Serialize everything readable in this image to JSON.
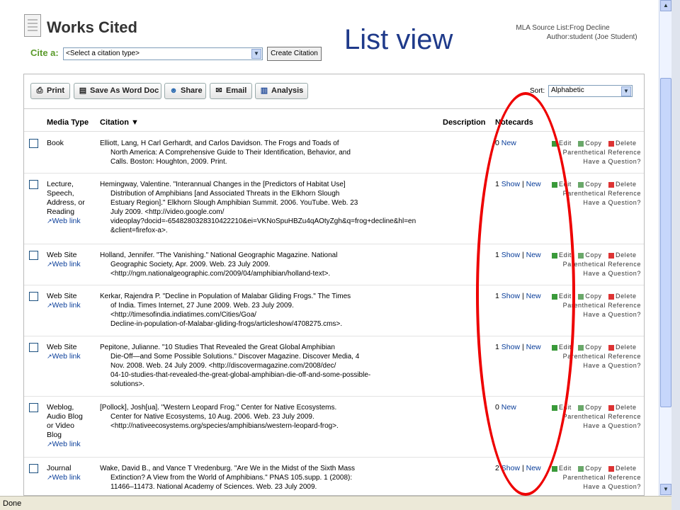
{
  "header": {
    "title": "Works Cited",
    "overlay_label": "List view",
    "source_list_key": "MLA Source List:",
    "source_list_value": "Frog Decline",
    "author_key": "Author:",
    "author_value": "student (Joe Student)",
    "cite_label": "Cite a:",
    "cite_select_value": "<Select a citation type>",
    "create_button": "Create Citation"
  },
  "toolbar": {
    "print": "Print",
    "word": "Save As Word Doc",
    "share": "Share",
    "email": "Email",
    "analysis": "Analysis",
    "sort_label": "Sort:",
    "sort_value": "Alphabetic"
  },
  "columns": {
    "media_type": "Media Type",
    "citation": "Citation ▼",
    "description": "Description",
    "notecards": "Notecards"
  },
  "actions": {
    "edit": "Edit",
    "copy": "Copy",
    "delete": "Delete",
    "parenthetical": "Parenthetical Reference",
    "question": "Have a Question?"
  },
  "links": {
    "web_link": "Web link",
    "show": "Show",
    "new": "New",
    "sep": "|"
  },
  "rows": [
    {
      "media": [
        "Book"
      ],
      "web_link": false,
      "citation": [
        "Elliott, Lang, H Carl Gerhardt, and Carlos Davidson. The Frogs and Toads of",
        "North America: A Comprehensive Guide to Their Identification, Behavior, and",
        "Calls. Boston: Houghton, 2009. Print."
      ],
      "count": "0",
      "show": false
    },
    {
      "media": [
        "Lecture,",
        "Speech,",
        "Address, or",
        "Reading"
      ],
      "web_link": true,
      "citation": [
        "Hemingway, Valentine. \"Interannual Changes in the [Predictors of Habitat Use]",
        "Distribution of Amphibians [and Associated Threats in the Elkhorn Slough",
        "Estuary Region].\" Elkhorn Slough Amphibian Summit. 2006. YouTube. Web. 23",
        "July 2009. <http://video.google.com/",
        "videoplay?docid=-6548280328310422210&ei=VKNoSpuHBZu4qAOtyZgh&q=frog+decline&hl=en",
        "&client=firefox-a>."
      ],
      "count": "1",
      "show": true
    },
    {
      "media": [
        "Web Site"
      ],
      "web_link": true,
      "citation": [
        "Holland, Jennifer. \"The Vanishing.\" National Geographic Magazine. National",
        "Geographic Society, Apr. 2009. Web. 23 July 2009.",
        "<http://ngm.nationalgeographic.com/2009/04/amphibian/holland-text>."
      ],
      "count": "1",
      "show": true
    },
    {
      "media": [
        "Web Site"
      ],
      "web_link": true,
      "citation": [
        "Kerkar, Rajendra P. \"Decline in Population of Malabar Gliding Frogs.\" The Times",
        "of India. Times Internet, 27 June 2009. Web. 23 July 2009.",
        "<http://timesofindia.indiatimes.com/Cities/Goa/",
        "Decline-in-population-of-Malabar-gliding-frogs/articleshow/4708275.cms>."
      ],
      "count": "1",
      "show": true
    },
    {
      "media": [
        "Web Site"
      ],
      "web_link": true,
      "citation": [
        "Pepitone, Julianne. \"10 Studies That Revealed the Great Global Amphibian",
        "Die-Off—and Some Possible Solutions.\" Discover Magazine. Discover Media, 4",
        "Nov. 2008. Web. 24 July 2009. <http://discovermagazine.com/2008/dec/",
        "04-10-studies-that-revealed-the-great-global-amphibian-die-off-and-some-possible-",
        "solutions>."
      ],
      "count": "1",
      "show": true
    },
    {
      "media": [
        "Weblog,",
        "Audio Blog",
        "or Video",
        "Blog"
      ],
      "web_link": true,
      "citation": [
        "[Pollock], Josh[ua]. \"Western Leopard Frog.\" Center for Native Ecosystems.",
        "Center for Native Ecosystems, 10 Aug. 2006. Web. 23 July 2009.",
        "<http://nativeecosystems.org/species/amphibians/western-leopard-frog>."
      ],
      "count": "0",
      "show": false
    },
    {
      "media": [
        "Journal"
      ],
      "web_link": true,
      "citation": [
        "Wake, David B., and Vance T Vredenburg. \"Are We in the Midst of the Sixth Mass",
        "Extinction? A View from the World of Amphibians.\" PNAS 105.supp. 1 (2008):",
        "11466–11473. National Academy of Sciences. Web. 23 July 2009."
      ],
      "count": "2",
      "show": true
    }
  ],
  "status": {
    "text": "Done"
  },
  "colors": {
    "accent": "#5a9a2a",
    "link": "#0a3e9a",
    "highlight": "#e00000"
  }
}
